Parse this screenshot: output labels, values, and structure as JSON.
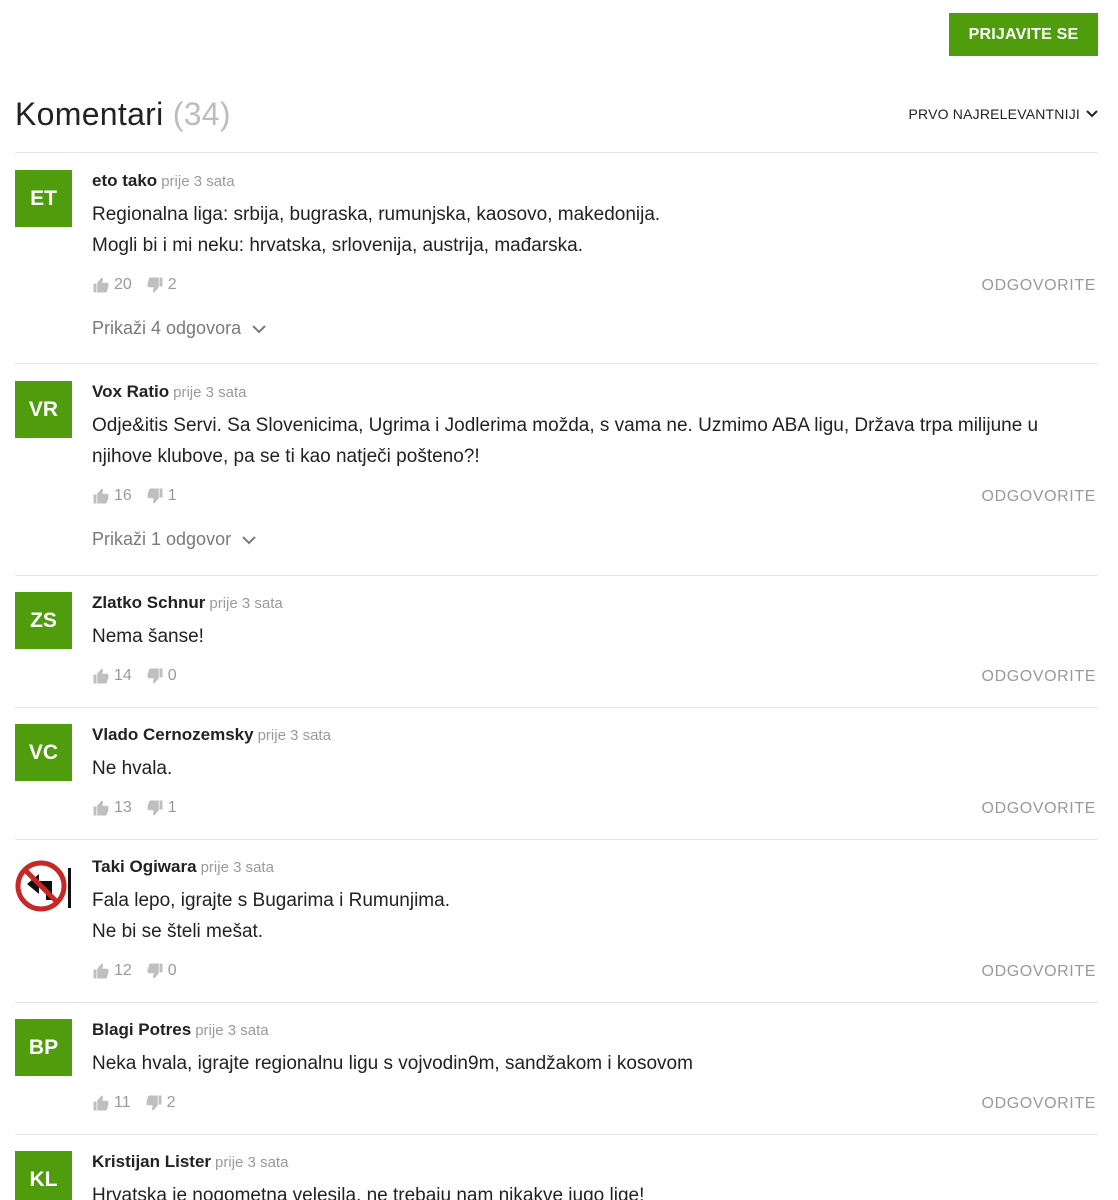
{
  "header": {
    "login_label": "PRIJAVITE SE"
  },
  "comments_section": {
    "title": "Komentari",
    "count": "(34)",
    "sort_label": "PRVO NAJRELEVANTNIJI"
  },
  "colors": {
    "accent": "#4f9d0d",
    "muted": "#9a9a9a"
  },
  "comments": [
    {
      "initials": "ET",
      "author": "eto tako",
      "time": "prije 3 sata",
      "lines": [
        "Regionalna liga: srbija, bugraska, rumunjska, kaosovo, makedonija.",
        "Mogli bi i mi neku: hrvatska, srlovenija, austrija, mađarska."
      ],
      "likes": "20",
      "dislikes": "2",
      "reply_label": "ODGOVORITE",
      "replies_label": "Prikaži 4 odgovora"
    },
    {
      "initials": "VR",
      "author": "Vox Ratio",
      "time": "prije 3 sata",
      "lines": [
        "Odje&itis Servi. Sa Slovenicima, Ugrima i Jodlerima možda, s vama ne. Uzmimo ABA ligu, Država trpa milijune u njihove klubove, pa se ti kao natječi pošteno?!"
      ],
      "likes": "16",
      "dislikes": "1",
      "reply_label": "ODGOVORITE",
      "replies_label": "Prikaži 1 odgovor"
    },
    {
      "initials": "ZS",
      "author": "Zlatko Schnur",
      "time": "prije 3 sata",
      "lines": [
        "Nema šanse!"
      ],
      "likes": "14",
      "dislikes": "0",
      "reply_label": "ODGOVORITE"
    },
    {
      "initials": "VC",
      "author": "Vlado Cernozemsky",
      "time": "prije 3 sata",
      "lines": [
        "Ne hvala."
      ],
      "likes": "13",
      "dislikes": "1",
      "reply_label": "ODGOVORITE"
    },
    {
      "avatar_icon": "no-left-turn-sign-icon",
      "author": "Taki Ogiwara",
      "time": "prije 3 sata",
      "lines": [
        "Fala lepo, igrajte s Bugarima i Rumunjima.",
        "Ne bi se šteli mešat."
      ],
      "likes": "12",
      "dislikes": "0",
      "reply_label": "ODGOVORITE"
    },
    {
      "initials": "BP",
      "author": "Blagi Potres",
      "time": "prije 3 sata",
      "lines": [
        "Neka hvala, igrajte regionalnu ligu s vojvodin9m, sandžakom i kosovom"
      ],
      "likes": "11",
      "dislikes": "2",
      "reply_label": "ODGOVORITE"
    },
    {
      "initials": "KL",
      "author": "Kristijan Lister",
      "time": "prije 3 sata",
      "lines": [
        "Hrvatska je nogometna velesila, ne trebaju nam nikakve jugo lige!"
      ]
    }
  ]
}
